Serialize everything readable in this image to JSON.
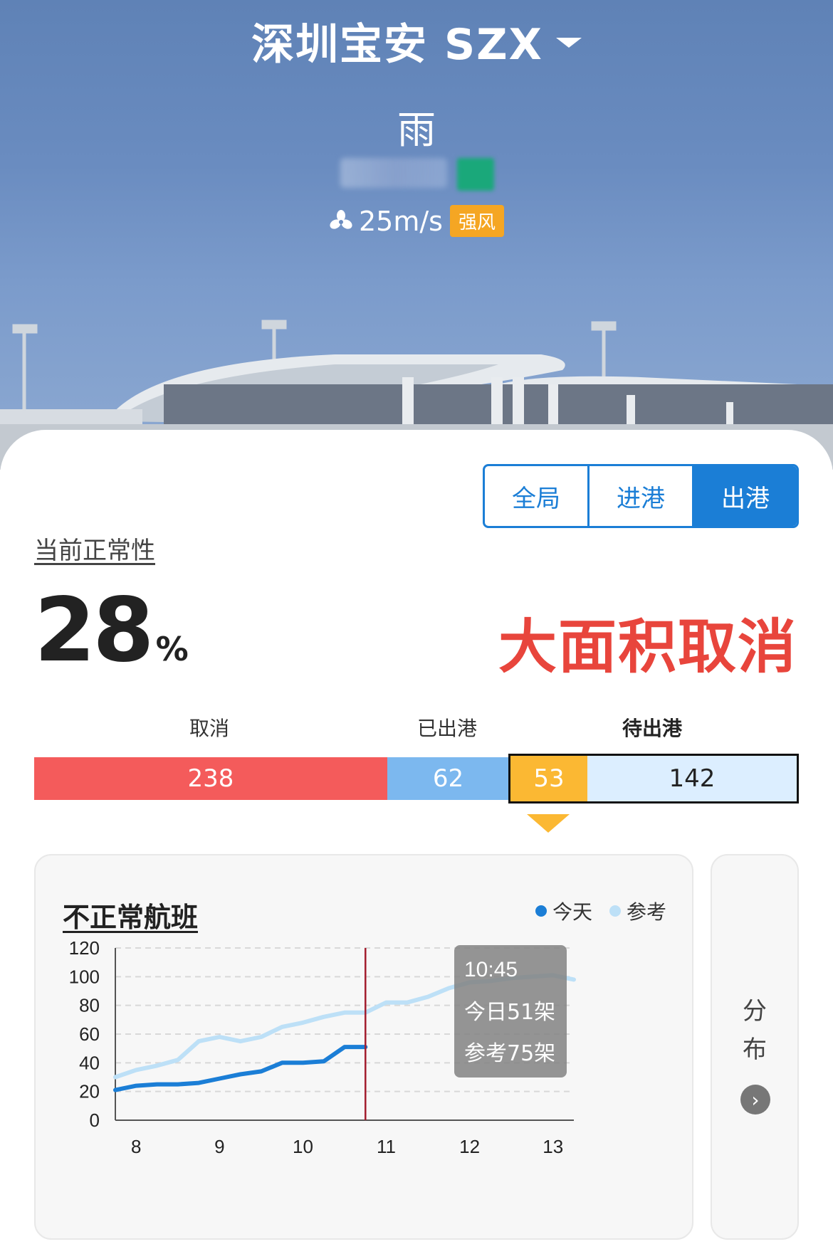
{
  "header": {
    "airport_title": "深圳宝安 SZX",
    "weather": "雨",
    "wind_speed": "25m/s",
    "wind_badge": "强风"
  },
  "tabs": [
    {
      "label": "全局",
      "active": false
    },
    {
      "label": "进港",
      "active": false
    },
    {
      "label": "出港",
      "active": true
    }
  ],
  "ontime": {
    "label": "当前正常性",
    "value": "28",
    "unit": "%",
    "status": "大面积取消"
  },
  "departure_bar": {
    "labels": {
      "cancelled": "取消",
      "departed": "已出港",
      "pending": "待出港"
    },
    "cancelled": "238",
    "departed": "62",
    "delayed": "53",
    "pending": "142"
  },
  "side_panel": {
    "label": "分\n布"
  },
  "colors": {
    "primary": "#1b7ed6",
    "cancel": "#f45b5b",
    "departed": "#7cb8ef",
    "delayed": "#fbb833",
    "pending": "#dceeff",
    "status_red": "#e8453c",
    "today_line": "#1b7ed6",
    "reference_line": "#bde0f7",
    "now_marker": "#a31d2e"
  },
  "chart_data": {
    "type": "line",
    "title": "不正常航班",
    "legend": [
      "今天",
      "参考"
    ],
    "x_ticks": [
      "8",
      "9",
      "10",
      "11",
      "12",
      "13"
    ],
    "y_ticks": [
      "120",
      "100",
      "80",
      "60",
      "40",
      "20",
      "0"
    ],
    "xlim": [
      7.75,
      13.25
    ],
    "ylim": [
      0,
      120
    ],
    "grid": true,
    "legend_position": "top-right",
    "now_marker_x": 10.75,
    "series": [
      {
        "name": "今天",
        "color": "#1b7ed6",
        "points": [
          [
            7.75,
            21
          ],
          [
            8.0,
            24
          ],
          [
            8.25,
            25
          ],
          [
            8.5,
            25
          ],
          [
            8.75,
            26
          ],
          [
            9.0,
            29
          ],
          [
            9.25,
            32
          ],
          [
            9.5,
            34
          ],
          [
            9.75,
            40
          ],
          [
            10.0,
            40
          ],
          [
            10.25,
            41
          ],
          [
            10.5,
            51
          ],
          [
            10.75,
            51
          ]
        ]
      },
      {
        "name": "参考",
        "color": "#bde0f7",
        "points": [
          [
            7.75,
            30
          ],
          [
            8.0,
            35
          ],
          [
            8.25,
            38
          ],
          [
            8.5,
            42
          ],
          [
            8.75,
            55
          ],
          [
            9.0,
            58
          ],
          [
            9.25,
            55
          ],
          [
            9.5,
            58
          ],
          [
            9.75,
            65
          ],
          [
            10.0,
            68
          ],
          [
            10.25,
            72
          ],
          [
            10.5,
            75
          ],
          [
            10.75,
            75
          ],
          [
            11.0,
            82
          ],
          [
            11.25,
            82
          ],
          [
            11.5,
            86
          ],
          [
            11.75,
            92
          ],
          [
            12.0,
            96
          ],
          [
            12.25,
            97
          ],
          [
            12.5,
            99
          ],
          [
            12.75,
            100
          ],
          [
            13.0,
            101
          ],
          [
            13.25,
            98
          ]
        ]
      }
    ],
    "tooltip": {
      "time": "10:45",
      "today": "今日51架",
      "reference": "参考75架"
    }
  }
}
